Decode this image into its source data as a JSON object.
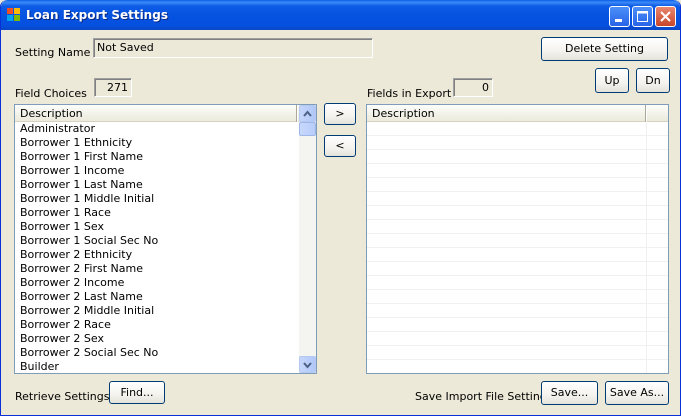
{
  "window": {
    "title": "Loan Export Settings",
    "icons": {
      "app": "app-windows-icon",
      "minimize": "minimize-icon",
      "maximize": "maximize-icon",
      "close": "close-icon"
    }
  },
  "setting": {
    "label": "Setting Name",
    "value": "Not Saved",
    "delete_label": "Delete Setting"
  },
  "field_choices": {
    "label": "Field Choices",
    "count": "271",
    "header": "Description",
    "items": [
      "Administrator",
      "Borrower 1 Ethnicity",
      "Borrower 1 First Name",
      "Borrower 1 Income",
      "Borrower 1 Last Name",
      "Borrower 1 Middle Initial",
      "Borrower 1 Race",
      "Borrower 1 Sex",
      "Borrower 1 Social Sec No",
      "Borrower 2 Ethnicity",
      "Borrower 2 First Name",
      "Borrower 2 Income",
      "Borrower 2 Last Name",
      "Borrower 2 Middle Initial",
      "Borrower 2 Race",
      "Borrower 2 Sex",
      "Borrower 2 Social Sec No",
      "Builder"
    ]
  },
  "move": {
    "add_label": ">",
    "remove_label": "<"
  },
  "fields_in_export": {
    "label": "Fields in Export",
    "count": "0",
    "header": "Description",
    "up_label": "Up",
    "down_label": "Dn"
  },
  "footer": {
    "retrieve_label": "Retrieve Settings",
    "find_label": "Find...",
    "save_import_label": "Save Import File Settings",
    "save_label": "Save...",
    "save_as_label": "Save As..."
  }
}
